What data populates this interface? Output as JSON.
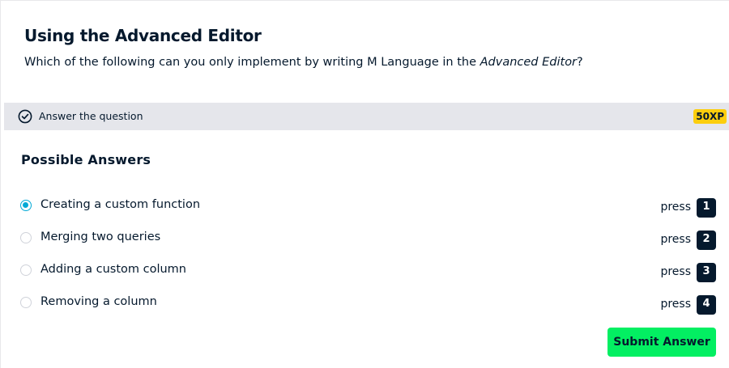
{
  "exercise": {
    "title": "Using the Advanced Editor",
    "question_before": "Which of the following can you only implement by writing M Language in the ",
    "question_emphasis": "Advanced Editor",
    "question_after": "?"
  },
  "instruction_bar": {
    "icon": "check-circle-icon",
    "label": "Answer the question",
    "xp": "50XP",
    "xp_color": "#fcce0d"
  },
  "answers": {
    "heading": "Possible Answers",
    "selected_index": 0,
    "options": [
      {
        "label": "Creating a custom function",
        "press_label": "press",
        "key": "1"
      },
      {
        "label": "Merging two queries",
        "press_label": "press",
        "key": "2"
      },
      {
        "label": "Adding a custom column",
        "press_label": "press",
        "key": "3"
      },
      {
        "label": "Removing a column",
        "press_label": "press",
        "key": "4"
      }
    ]
  },
  "submit": {
    "label": "Submit Answer",
    "color": "#03ef62"
  },
  "colors": {
    "text": "#05192d",
    "radio_selected": "#03a9d6",
    "bar_background": "#e5e6eb"
  }
}
